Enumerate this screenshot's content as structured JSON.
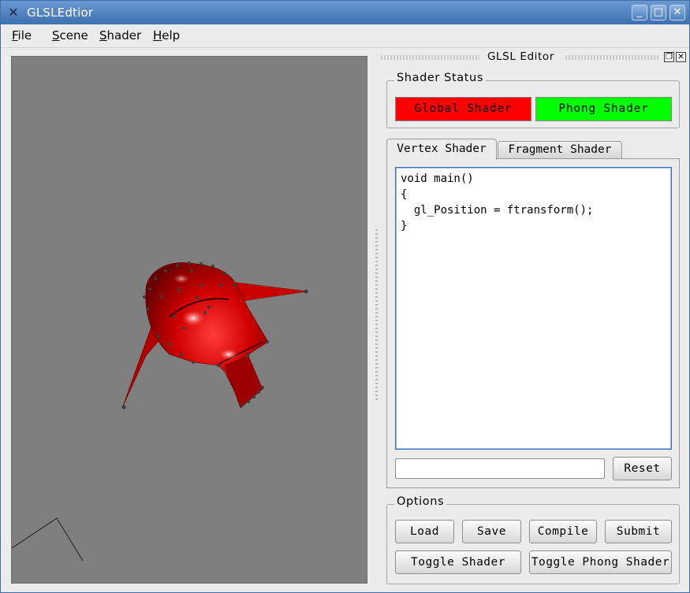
{
  "window": {
    "title": "GLSLEdtior",
    "icon": "x-logo-icon",
    "controls": [
      "minimize",
      "maximize",
      "close"
    ]
  },
  "menubar": {
    "items": [
      {
        "label": "File",
        "mnemonic": "F",
        "rest": "ile"
      },
      {
        "label": "Scene",
        "mnemonic": "S",
        "rest": "cene"
      },
      {
        "label": "Shader",
        "mnemonic": "S",
        "rest": "hader"
      },
      {
        "label": "Help",
        "mnemonic": "H",
        "rest": "elp"
      }
    ]
  },
  "dock": {
    "title": "GLSL Editor",
    "float_icon": "float-icon",
    "close_icon": "close-icon"
  },
  "shader_status": {
    "group_title": "Shader Status",
    "global": {
      "label": "Global Shader",
      "color": "#ff0000"
    },
    "phong": {
      "label": "Phong Shader",
      "color": "#00ff00"
    }
  },
  "tabs": {
    "items": [
      "Vertex Shader",
      "Fragment Shader"
    ],
    "active": "Vertex Shader"
  },
  "editor": {
    "code": "void main()\n{\n  gl_Position = ftransform();\n}"
  },
  "command": {
    "value": "",
    "reset_label": "Reset"
  },
  "options": {
    "group_title": "Options",
    "load_label": "Load",
    "save_label": "Save",
    "compile_label": "Compile",
    "submit_label": "Submit",
    "toggle_shader_label": "Toggle Shader",
    "toggle_phong_label": "Toggle Phong Shader"
  },
  "viewport": {
    "background": "#7f7f7f",
    "model_color": "#d40000"
  }
}
